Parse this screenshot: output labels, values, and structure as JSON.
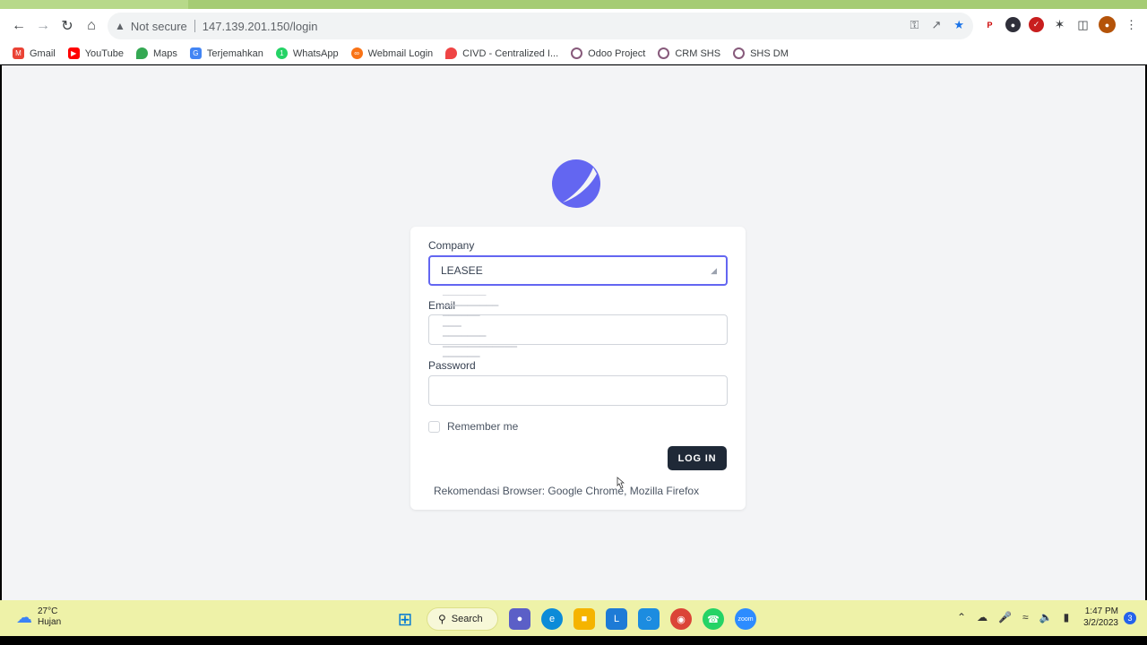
{
  "browser": {
    "security_text": "Not secure",
    "url": "147.139.201.150/login"
  },
  "bookmarks": [
    {
      "label": "Gmail",
      "color": "#ea4335"
    },
    {
      "label": "YouTube",
      "color": "#ff0000"
    },
    {
      "label": "Maps",
      "color": "#34a853"
    },
    {
      "label": "Terjemahkan",
      "color": "#4285f4"
    },
    {
      "label": "WhatsApp",
      "color": "#25d366"
    },
    {
      "label": "Webmail Login",
      "color": "#f97316"
    },
    {
      "label": "CIVD - Centralized I...",
      "color": "#ef4444"
    },
    {
      "label": "Odoo Project",
      "color": "#875a7b"
    },
    {
      "label": "CRM SHS",
      "color": "#875a7b"
    },
    {
      "label": "SHS DM",
      "color": "#875a7b"
    }
  ],
  "login": {
    "company_label": "Company",
    "company_value": "LEASEE",
    "email_label": "Email",
    "password_label": "Password",
    "remember_label": "Remember me",
    "login_button": "LOG IN",
    "recommendation": "Rekomendasi Browser: Google Chrome, Mozilla Firefox",
    "accent_color": "#6366f1"
  },
  "taskbar": {
    "temperature": "27°C",
    "weather": "Hujan",
    "search_label": "Search",
    "time": "1:47 PM",
    "date": "3/2/2023",
    "notification_count": "3"
  }
}
